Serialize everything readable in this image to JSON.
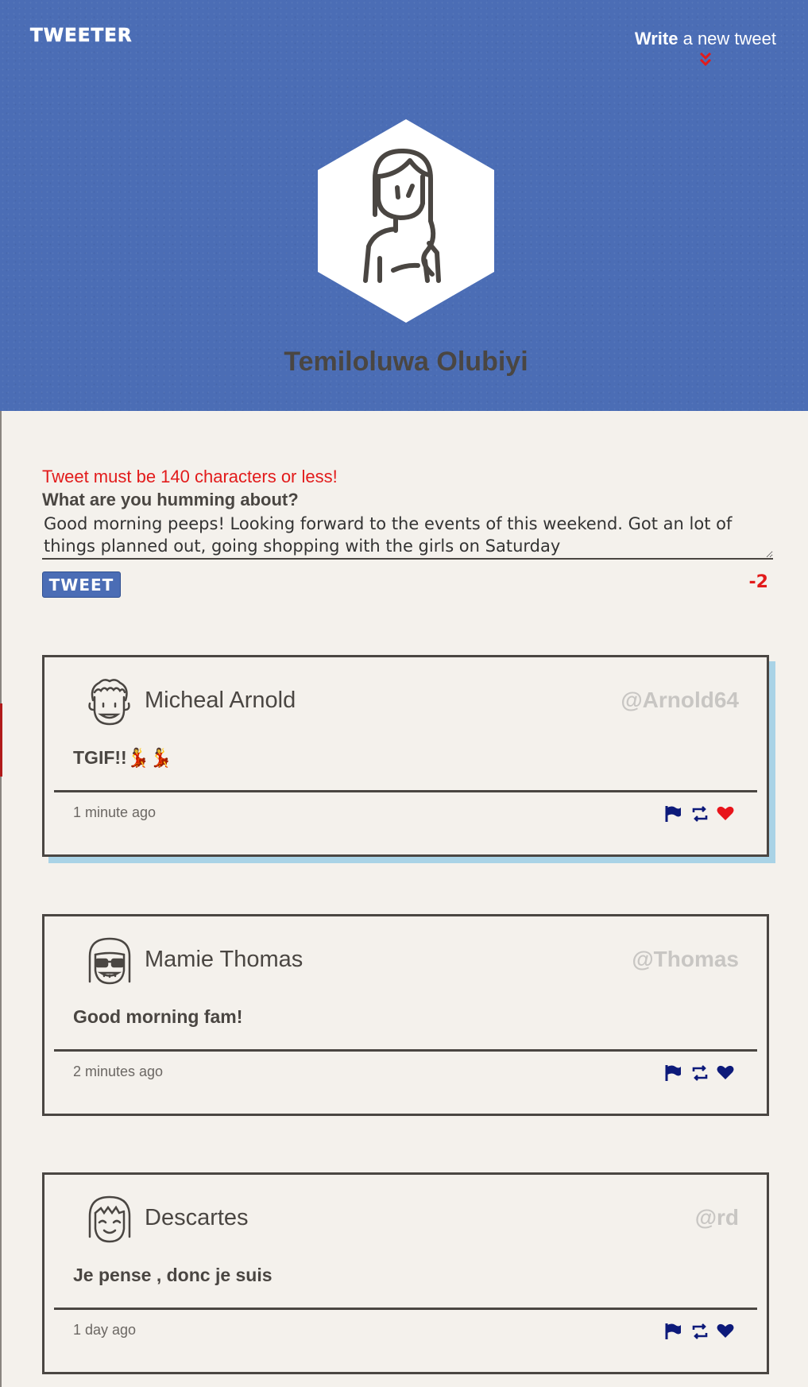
{
  "header": {
    "logo": "TWEETER",
    "compose_bold": "Write",
    "compose_rest": " a new tweet",
    "profile_name": "Temiloluwa Olubiyi"
  },
  "compose": {
    "error": "Tweet must be 140 characters or less!",
    "prompt": "What are you humming about?",
    "text": "Good morning peeps! Looking forward to the events of this weekend. Got an lot of things planned out, going shopping with the girls on Saturday",
    "button_label": "TWEET",
    "counter": "-2"
  },
  "colors": {
    "header_bg": "#4b6db5",
    "page_bg": "#f4f1ec",
    "error": "#e21b1b",
    "action_icons": "#0d1a7a",
    "liked": "#e8141b",
    "highlight_shadow": "#a9d3e6"
  },
  "tweets": [
    {
      "name": "Micheal Arnold",
      "handle": "@Arnold64",
      "content": "TGIF!!💃💃",
      "time": "1 minute ago",
      "avatar_icon": "curly-hair-man-icon",
      "liked": true
    },
    {
      "name": "Mamie Thomas",
      "handle": "@Thomas",
      "content": "Good morning fam!",
      "time": "2 minutes ago",
      "avatar_icon": "sunglasses-woman-icon",
      "liked": false
    },
    {
      "name": "Descartes",
      "handle": "@rd",
      "content": "Je pense , donc je suis",
      "time": "1 day ago",
      "avatar_icon": "bob-hair-smiling-icon",
      "liked": false
    }
  ]
}
